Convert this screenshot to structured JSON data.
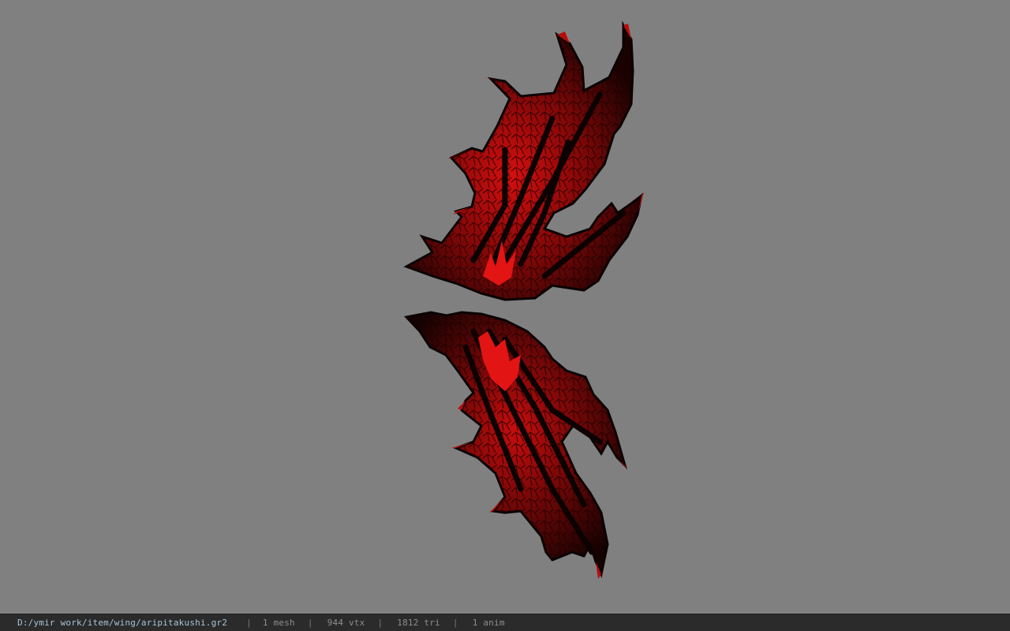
{
  "viewport": {
    "background_color": "#808080",
    "model": {
      "name": "aripitakushi",
      "colors": {
        "dark": "#0d0303",
        "mid": "#4a0606",
        "bright": "#e01010"
      }
    }
  },
  "status_bar": {
    "file_path": "D:/ymir work/item/wing/aripitakushi.gr2",
    "separator": "|",
    "mesh_count": "1 mesh",
    "vertex_count": "944 vtx",
    "triangle_count": "1812 tri",
    "anim_count": "1 anim"
  }
}
